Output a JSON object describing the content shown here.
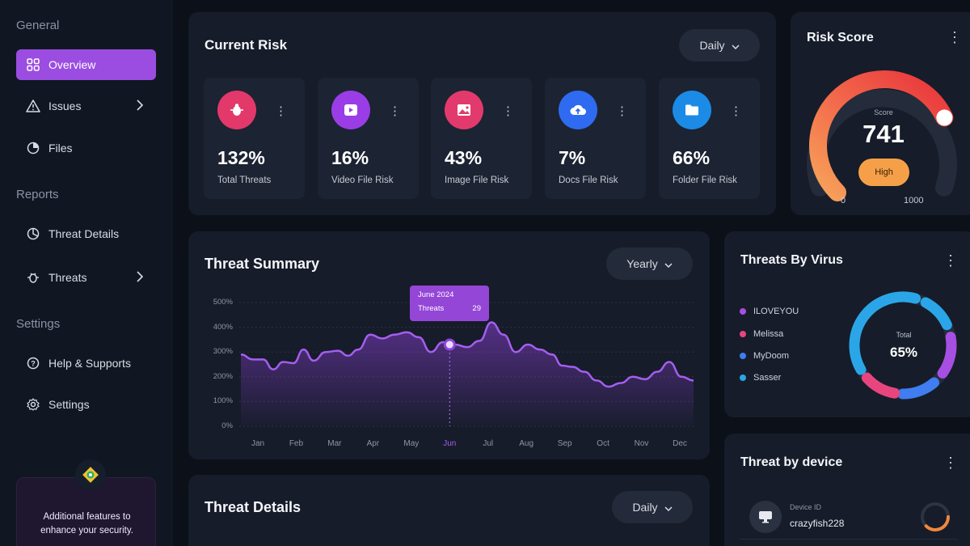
{
  "sidebar": {
    "sections": [
      "General",
      "Reports",
      "Settings"
    ],
    "items": [
      {
        "label": "Overview",
        "icon": "grid-icon",
        "active": true
      },
      {
        "label": "Issues",
        "icon": "warning-icon"
      },
      {
        "label": "Files",
        "icon": "file-icon"
      },
      {
        "label": "Threat Details",
        "icon": "chart-icon"
      },
      {
        "label": "Threats",
        "icon": "bug-icon"
      },
      {
        "label": "Help & Supports",
        "icon": "help-icon"
      },
      {
        "label": "Settings",
        "icon": "gear-icon"
      }
    ],
    "promo": {
      "text": "Additional features to enhance your security."
    }
  },
  "current_risk": {
    "title": "Current Risk",
    "period": "Daily",
    "tiles": [
      {
        "value": "132%",
        "label": "Total Threats",
        "color": "#e2386a",
        "icon": "bug-icon"
      },
      {
        "value": "16%",
        "label": "Video File Risk",
        "color": "#9a3de6",
        "icon": "video-icon"
      },
      {
        "value": "43%",
        "label": "Image File Risk",
        "color": "#e23a6c",
        "icon": "image-icon"
      },
      {
        "value": "7%",
        "label": "Docs File Risk",
        "color": "#2f6bf0",
        "icon": "cloud-upload-icon"
      },
      {
        "value": "66%",
        "label": "Folder File Risk",
        "color": "#1b8be6",
        "icon": "folder-icon"
      }
    ]
  },
  "risk_score": {
    "title": "Risk Score",
    "caption": "Score",
    "score": "741",
    "level": "High",
    "min": "0",
    "max": "1000",
    "score_fraction": 0.741
  },
  "threat_summary": {
    "title": "Threat Summary",
    "period": "Yearly",
    "tooltip": {
      "month": "June 2024",
      "label": "Threats",
      "value": "29"
    }
  },
  "threats_by_virus": {
    "title": "Threats By Virus",
    "total_label": "Total",
    "total_value": "65%",
    "legend": [
      {
        "name": "ILOVEYOU",
        "color": "#a64fe2"
      },
      {
        "name": "Melissa",
        "color": "#e8457f"
      },
      {
        "name": "MyDoom",
        "color": "#3f7df0"
      },
      {
        "name": "Sasser",
        "color": "#2aa6e8"
      }
    ]
  },
  "threat_details": {
    "title": "Threat Details",
    "period": "Daily"
  },
  "threat_by_device": {
    "title": "Threat by device",
    "device_caption": "Device ID",
    "device_id": "crazyfish228"
  },
  "chart_data": {
    "type": "area",
    "categories": [
      "Jan",
      "Feb",
      "Mar",
      "Apr",
      "May",
      "Jun",
      "Jul",
      "Aug",
      "Sep",
      "Oct",
      "Nov",
      "Dec"
    ],
    "y_ticks": [
      "500%",
      "400%",
      "300%",
      "200%",
      "100%",
      "0%"
    ],
    "ylim": [
      0,
      500
    ],
    "highlight_category": "Jun",
    "x": [
      0,
      0.3,
      0.55,
      0.8,
      1.05,
      1.3,
      1.55,
      1.8,
      2.1,
      2.4,
      2.65,
      2.9,
      3.2,
      3.5,
      3.8,
      4.1,
      4.4,
      4.7,
      5.0,
      5.3,
      5.6,
      5.9,
      6.2,
      6.5,
      6.8,
      7.1,
      7.4,
      7.7,
      7.95,
      8.2,
      8.5,
      8.8,
      9.1,
      9.4,
      9.7,
      10.0,
      10.3,
      10.6,
      10.9,
      11.2
    ],
    "y": [
      290,
      270,
      270,
      230,
      260,
      255,
      310,
      265,
      300,
      305,
      285,
      310,
      370,
      355,
      370,
      380,
      360,
      300,
      340,
      330,
      320,
      345,
      420,
      370,
      300,
      330,
      310,
      290,
      245,
      240,
      220,
      185,
      160,
      175,
      200,
      190,
      220,
      260,
      200,
      185
    ],
    "series": [
      {
        "name": "Threats"
      }
    ]
  }
}
